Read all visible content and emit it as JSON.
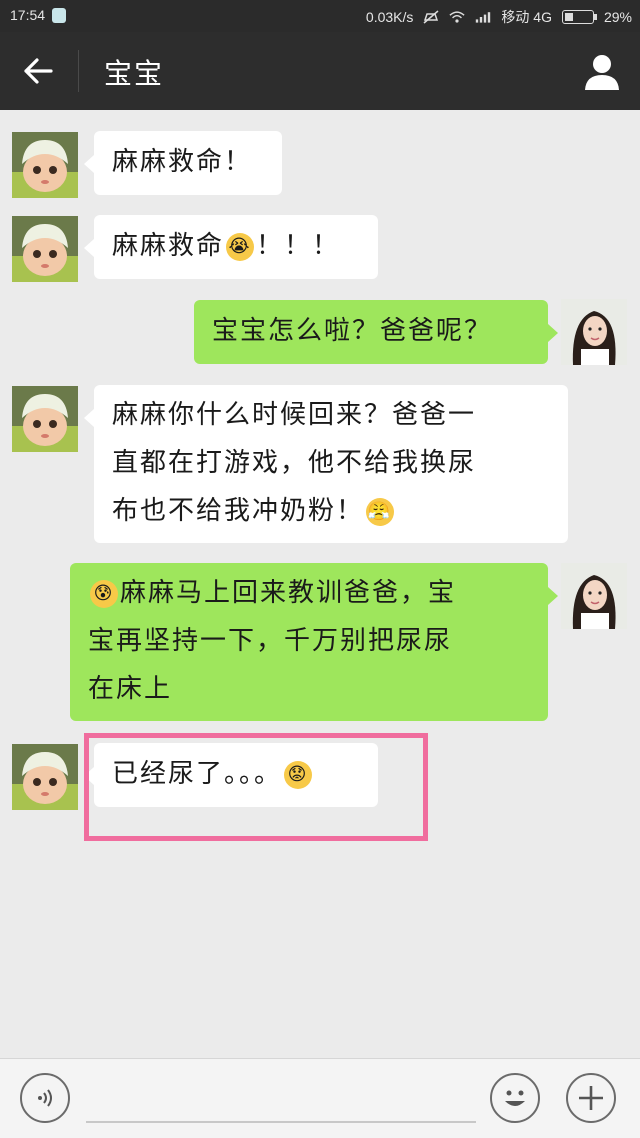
{
  "status_bar": {
    "time": "17:54",
    "net_speed": "0.03K/s",
    "carrier": "移动 4G",
    "battery": "29%",
    "battery_level": 0.29
  },
  "header": {
    "title": "宝宝"
  },
  "messages": [
    {
      "side": "left",
      "text": "麻麻救命！"
    },
    {
      "side": "left",
      "text": "麻麻救命",
      "emoji_after": "crying-emoji",
      "suffix": "！！！"
    },
    {
      "side": "right",
      "text": "宝宝怎么啦？爸爸呢？"
    },
    {
      "side": "left",
      "lines": [
        "麻麻你什么时候回来？爸爸一",
        "直都在打游戏，他不给我换尿",
        "布也不给我冲奶粉！"
      ],
      "emoji_after": "angry-emoji"
    },
    {
      "side": "right",
      "emoji_before": "fearful-emoji",
      "lines": [
        "麻麻马上回来教训爸爸，宝",
        "宝再坚持一下，千万别把尿尿",
        "在床上"
      ]
    },
    {
      "side": "left",
      "text": "已经尿了。。。",
      "emoji_after": "worried-emoji",
      "highlighted": true
    }
  ],
  "colors": {
    "sent_bubble": "#9ee65c",
    "received_bubble": "#ffffff",
    "header_bg": "#2d2d2d",
    "highlight": "#f06d9e"
  }
}
